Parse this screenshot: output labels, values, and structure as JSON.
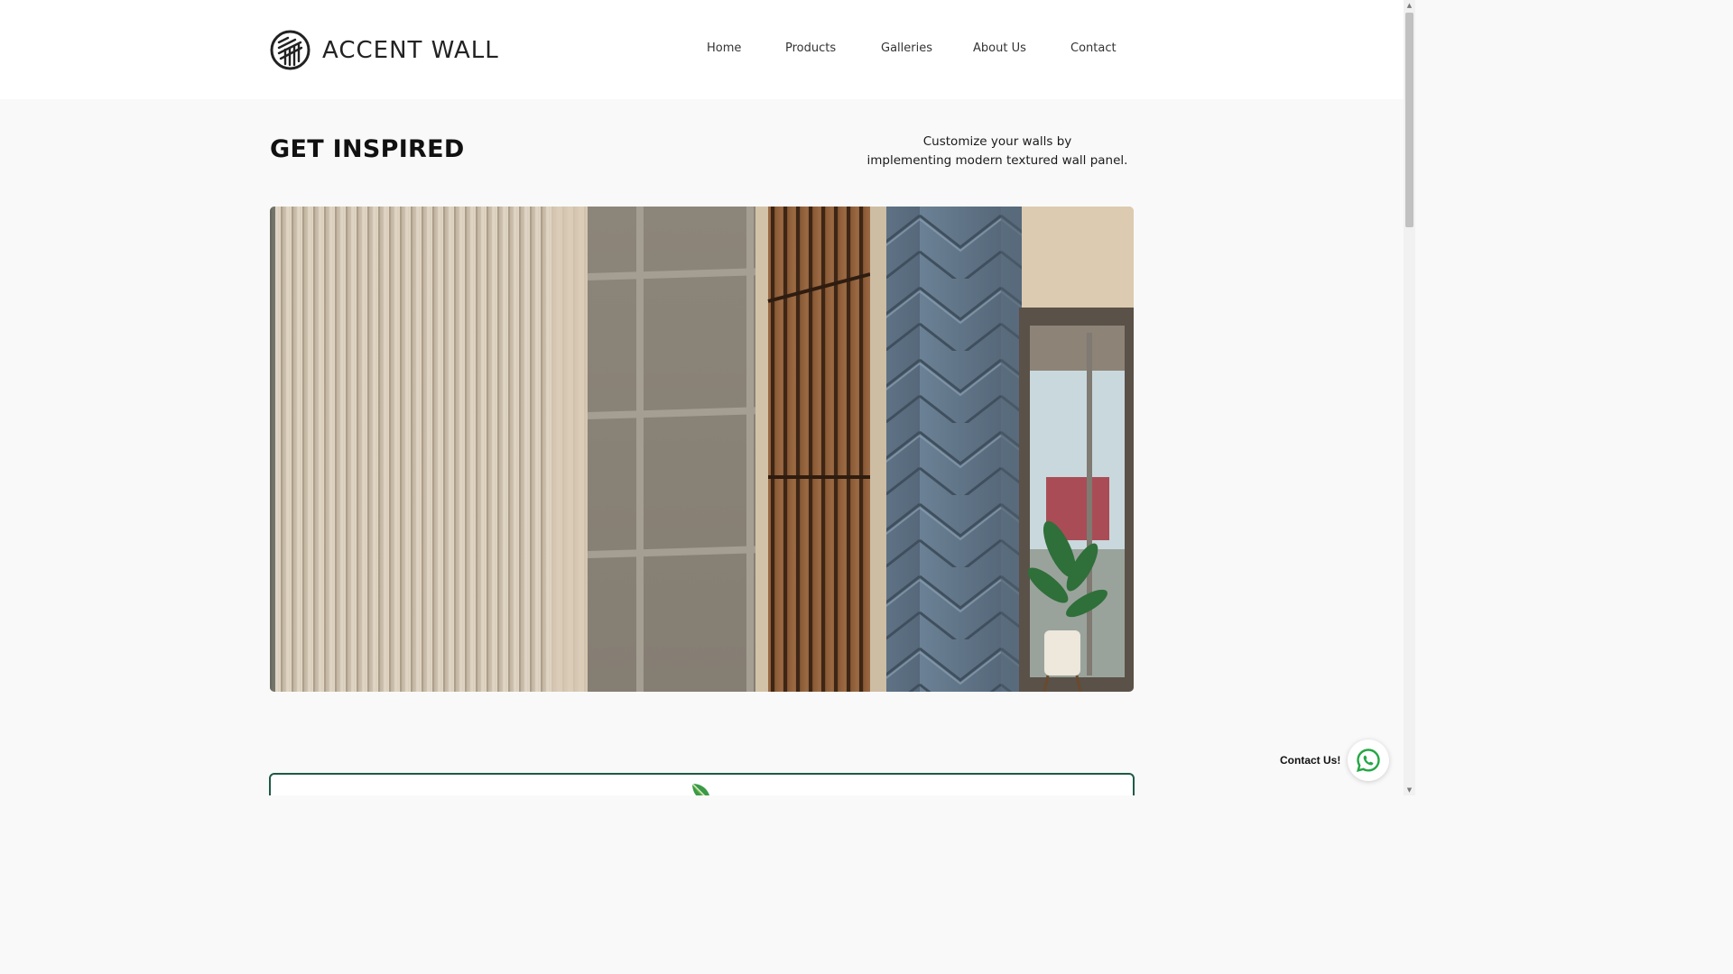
{
  "header": {
    "brand": "ACCENT WALL",
    "nav": [
      {
        "label": "Home"
      },
      {
        "label": "Products"
      },
      {
        "label": "Galleries"
      },
      {
        "label": "About Us"
      },
      {
        "label": "Contact"
      }
    ]
  },
  "hero": {
    "title": "GET INSPIRED",
    "tagline_line1": "Customize your walls by",
    "tagline_line2": "implementing modern textured wall panel."
  },
  "floating_contact": {
    "label": "Contact Us!",
    "icon": "whatsapp-icon"
  },
  "colors": {
    "card_border": "#1e5a45",
    "whatsapp": "#25a745"
  }
}
